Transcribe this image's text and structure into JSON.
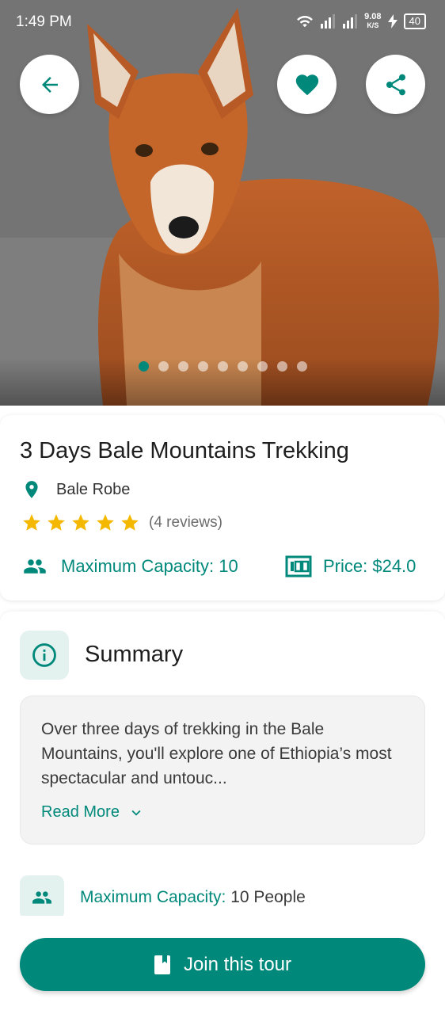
{
  "status_bar": {
    "time": "1:49 PM",
    "network_speed": "9.08",
    "network_unit": "K/S",
    "battery": "40"
  },
  "hero": {
    "image_subject": "ethiopian-wolf-photo",
    "slide_count": 9,
    "active_slide": 1
  },
  "tour": {
    "title": "3 Days Bale Mountains Trekking",
    "location": "Bale Robe",
    "rating": 5,
    "reviews": "(4 reviews)",
    "capacity": "Maximum Capacity: 10",
    "price": "Price: $24.0"
  },
  "summary": {
    "heading": "Summary",
    "text": "Over three days of trekking in the Bale Mountains, you'll explore one of Ethiopia’s most spectacular and untouc...",
    "read_more": "Read More"
  },
  "capacity_detail": {
    "label": "Maximum Capacity:",
    "value": " 10 People"
  },
  "cta": {
    "join_label": "Join this tour"
  },
  "colors": {
    "accent": "#00897b",
    "accent_light": "#e3f1ef",
    "star": "#f5b800"
  }
}
